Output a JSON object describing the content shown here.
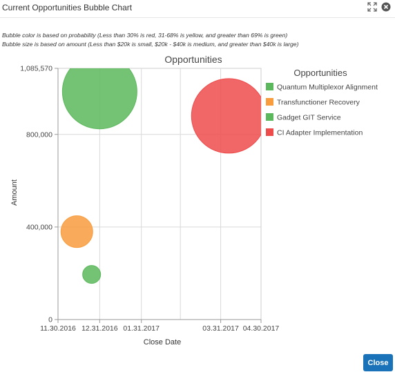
{
  "dialog": {
    "title": "Current Opportunities Bubble Chart",
    "close_label": "Close",
    "notes": [
      "Bubble color is based on probability (Less than 30% is red, 31-68% is yellow, and greater than 69% is green)",
      "Bubble size is based on amount (Less than $20k is small, $20k - $40k is medium, and greater than $40k is large)"
    ]
  },
  "icons": {
    "expand": "expand-icon",
    "close": "close-circle-icon"
  },
  "colors": {
    "green": "#5cb85c",
    "orange": "#f89c3e",
    "red": "#ee4b4b",
    "button": "#1a73b8"
  },
  "chart_data": {
    "type": "scatter",
    "title": "Opportunities",
    "xlabel": "Close Date",
    "ylabel": "Amount",
    "x_ticks": [
      "11.30.2016",
      "12.31.2016",
      "01.31.2017",
      "03.31.2017",
      "04.30.2017"
    ],
    "y_ticks": [
      "0",
      "400,000",
      "800,000",
      "1,085,570"
    ],
    "ylim": [
      0,
      1085570
    ],
    "xlim": [
      "2016-11-30",
      "2017-04-30"
    ],
    "legend": {
      "title": "Opportunities",
      "position": "right"
    },
    "series": [
      {
        "name": "Quantum Multiplexor Alignment",
        "x": "2016-12-31",
        "y": 985000,
        "size": "large",
        "color": "#5cb85c"
      },
      {
        "name": "Transfunctioner Recovery",
        "x": "2016-12-14",
        "y": 380000,
        "size": "medium",
        "color": "#f89c3e"
      },
      {
        "name": "Gadget GIT Service",
        "x": "2016-12-25",
        "y": 195000,
        "size": "small",
        "color": "#5cb85c"
      },
      {
        "name": "CI Adapter Implementation",
        "x": "2017-04-06",
        "y": 880000,
        "size": "large",
        "color": "#ee4b4b"
      }
    ]
  }
}
